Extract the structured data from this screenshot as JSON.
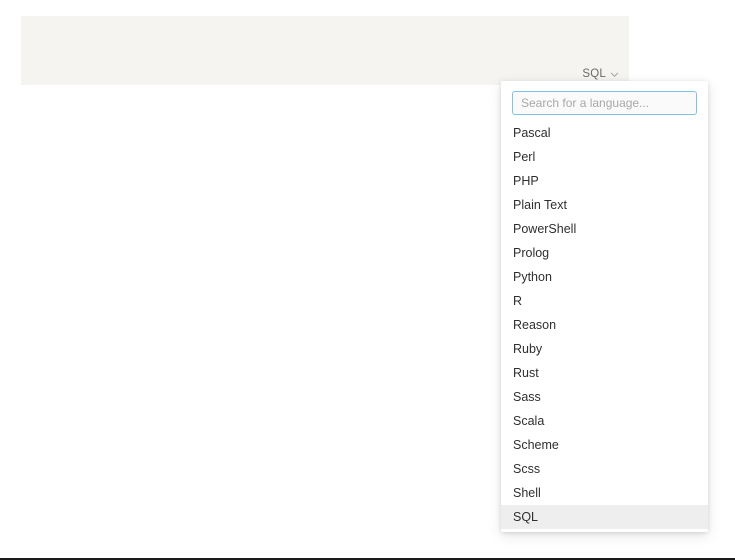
{
  "editor": {
    "code": "",
    "language_button": {
      "label": "SQL",
      "icon": "chevron-down-icon"
    }
  },
  "dropdown": {
    "search": {
      "placeholder": "Search for a language...",
      "value": ""
    },
    "selected": "SQL",
    "items": [
      {
        "label": "Pascal"
      },
      {
        "label": "Perl"
      },
      {
        "label": "PHP"
      },
      {
        "label": "Plain Text"
      },
      {
        "label": "PowerShell"
      },
      {
        "label": "Prolog"
      },
      {
        "label": "Python"
      },
      {
        "label": "R"
      },
      {
        "label": "Reason"
      },
      {
        "label": "Ruby"
      },
      {
        "label": "Rust"
      },
      {
        "label": "Sass"
      },
      {
        "label": "Scala"
      },
      {
        "label": "Scheme"
      },
      {
        "label": "Scss"
      },
      {
        "label": "Shell"
      },
      {
        "label": "SQL"
      }
    ]
  },
  "colors": {
    "editor_background": "#f6f4f1",
    "panel_background": "#ffffff",
    "selected_item": "#eeeeee",
    "focus_border": "#7fc4e8",
    "text": "#2f2f2f",
    "muted_text": "#6b6b6b",
    "placeholder": "#a8a8a8"
  }
}
